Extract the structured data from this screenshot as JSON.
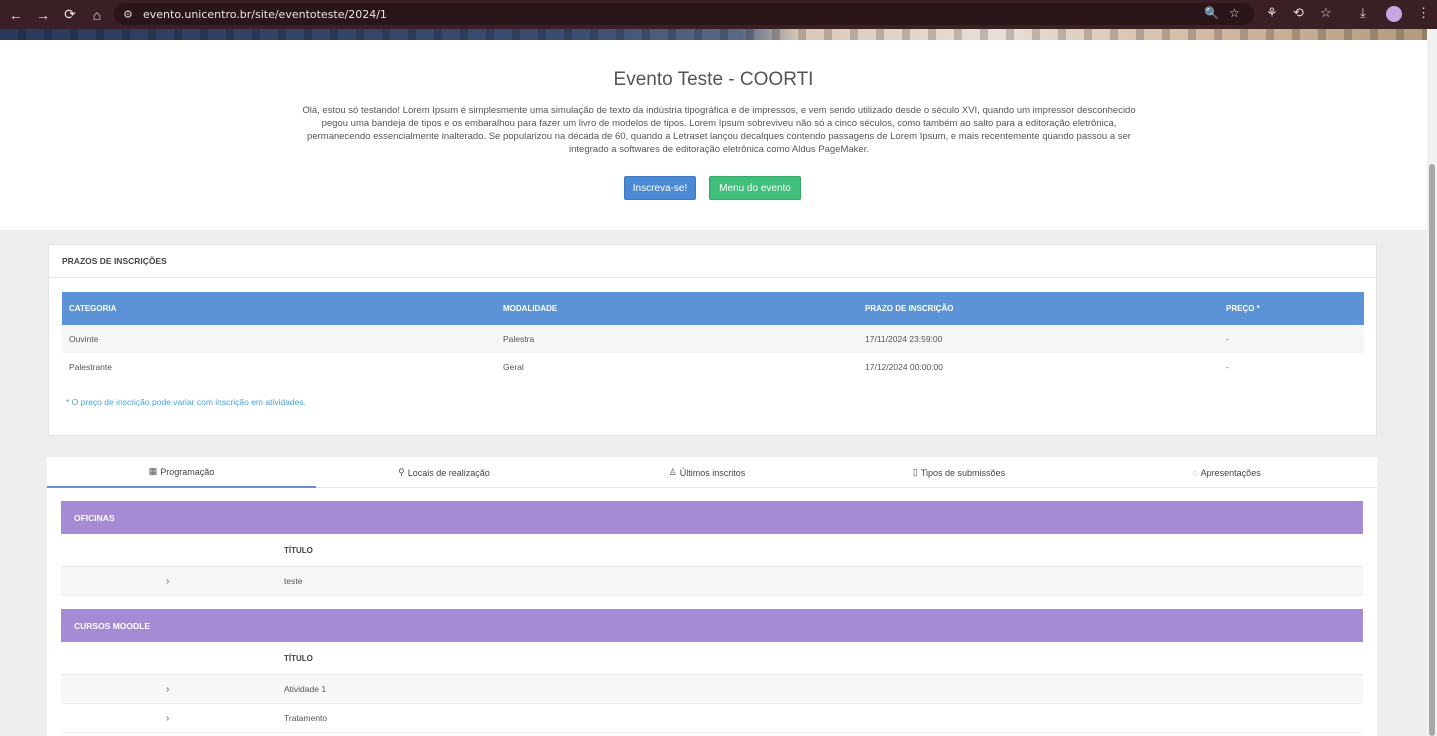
{
  "browser": {
    "url": "evento.unicentro.br/site/eventoteste/2024/1",
    "back_icon": "←",
    "forward_icon": "→",
    "reload_icon": "⟳",
    "home_icon": "⌂",
    "tune_icon": "⚙",
    "zoom_icon": "🔍",
    "star_icon": "☆",
    "extensions_icon": "⚘",
    "history_icon": "⟲",
    "bookmarks_icon": "☆",
    "download_icon": "⤓",
    "menu_icon": "⋮"
  },
  "hero": {
    "title": "Evento Teste - COORTI",
    "description": "Olá, estou só testando! Lorem Ipsum é simplesmente uma simulação de texto da indústria tipográfica e de impressos, e vem sendo utilizado desde o século XVI, quando um impressor desconhecido pegou uma bandeja de tipos e os embaralhou para fazer um livro de modelos de tipos. Lorem Ipsum sobreviveu não só a cinco séculos, como também ao salto para a editoração eletrônica, permanecendo essencialmente inalterado. Se popularizou na década de 60, quando a Letraset lançou decalques contendo passagens de Lorem Ipsum, e mais recentemente quando passou a ser integrado a softwares de editoração eletrônica como Aldus PageMaker.",
    "subscribe_label": "Inscreva-se!",
    "menu_label": "Menu do evento"
  },
  "prazos": {
    "title": "PRAZOS DE INSCRIÇÕES",
    "headers": [
      "CATEGORIA",
      "MODALIDADE",
      "PRAZO DE INSCRIÇÃO",
      "PREÇO *"
    ],
    "rows": [
      [
        "Ouvinte",
        "Palestra",
        "17/11/2024 23:59:00",
        "-"
      ],
      [
        "Palestrante",
        "Geral",
        "17/12/2024 00:00:00",
        "-"
      ]
    ],
    "note": "* O preço de inscrição pode variar com inscrição em atividades."
  },
  "tabs": [
    {
      "label": "Programação",
      "icon": "▦"
    },
    {
      "label": "Locais de realização",
      "icon": "⚲"
    },
    {
      "label": "Últimos inscritos",
      "icon": "♙"
    },
    {
      "label": "Tipos de submissões",
      "icon": "▯"
    },
    {
      "label": "Apresentações",
      "icon": "◌"
    }
  ],
  "sections": [
    {
      "title": "OFICINAS",
      "column": "TÍTULO",
      "rows": [
        {
          "chevron": "›",
          "title": "teste"
        }
      ]
    },
    {
      "title": "CURSOS MOODLE",
      "column": "TÍTULO",
      "rows": [
        {
          "chevron": "›",
          "title": "Atividade 1"
        },
        {
          "chevron": "›",
          "title": "Tratamento"
        }
      ]
    }
  ],
  "colors": {
    "table_header": "#5b93d6",
    "section_header": "#a58ad6",
    "primary_button": "#4a8ad4",
    "success_button": "#3fbf7a"
  }
}
